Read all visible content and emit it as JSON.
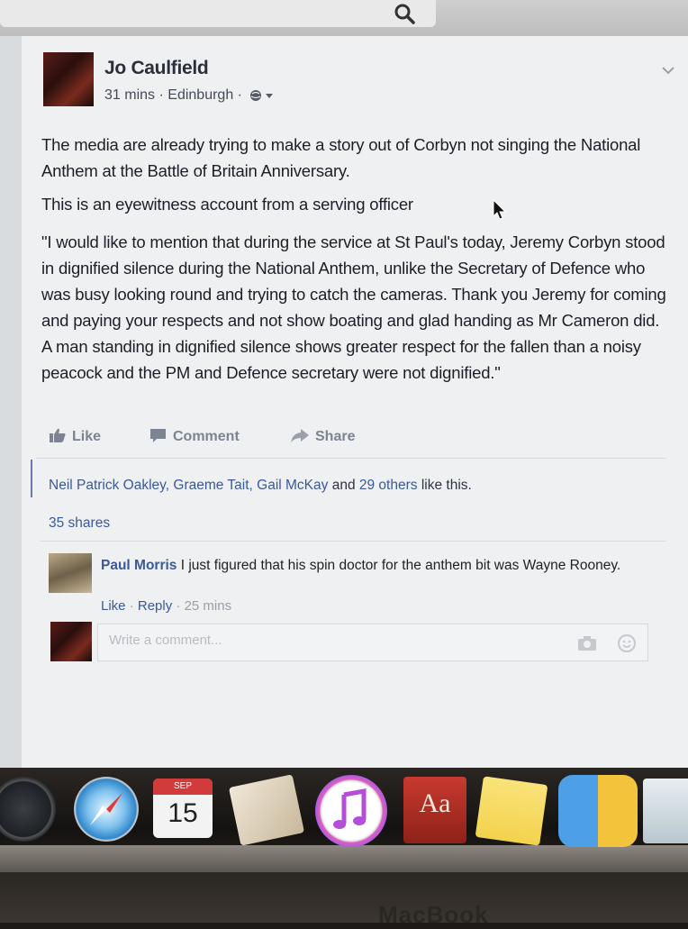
{
  "post": {
    "author": "Jo Caulfield",
    "time": "31 mins",
    "location": "Edinburgh",
    "paragraphs": [
      "The media are already trying to make a story out of Corbyn not singing the National Anthem at the Battle of Britain Anniversary.",
      "This is an eyewitness account from a serving officer",
      "\"I would like to mention that during the service at St Paul's today, Jeremy Corbyn stood in dignified silence during the National Anthem, unlike the Secretary of Defence who was busy looking round and trying to catch the cameras. Thank you Jeremy for coming and paying your respects and not show boating and glad handing as Mr Cameron did. A man standing in dignified silence shows greater respect for the fallen than a noisy peacock and the PM and Defence secretary were not dignified.\""
    ]
  },
  "actions": {
    "like": "Like",
    "comment": "Comment",
    "share": "Share"
  },
  "likes": {
    "names": "Neil Patrick Oakley, Graeme Tait, Gail McKay",
    "and": " and ",
    "others": "29 others",
    "suffix": " like this."
  },
  "shares": "35 shares",
  "comment": {
    "author": "Paul Morris",
    "text": " I just figured that his spin doctor for the anthem bit was Wayne Rooney.",
    "like": "Like",
    "reply": "Reply",
    "time": "25 mins"
  },
  "write_comment": {
    "placeholder": "Write a comment..."
  },
  "dock": {
    "calendar_month": "SEP",
    "calendar_day": "15",
    "dictionary_label": "Aa"
  },
  "bezel_brand": "MacBook",
  "icons": [
    "search-icon",
    "globe-icon",
    "chevron-down-icon",
    "cursor-icon",
    "like-icon",
    "comment-icon",
    "share-icon",
    "camera-icon",
    "smiley-icon"
  ]
}
